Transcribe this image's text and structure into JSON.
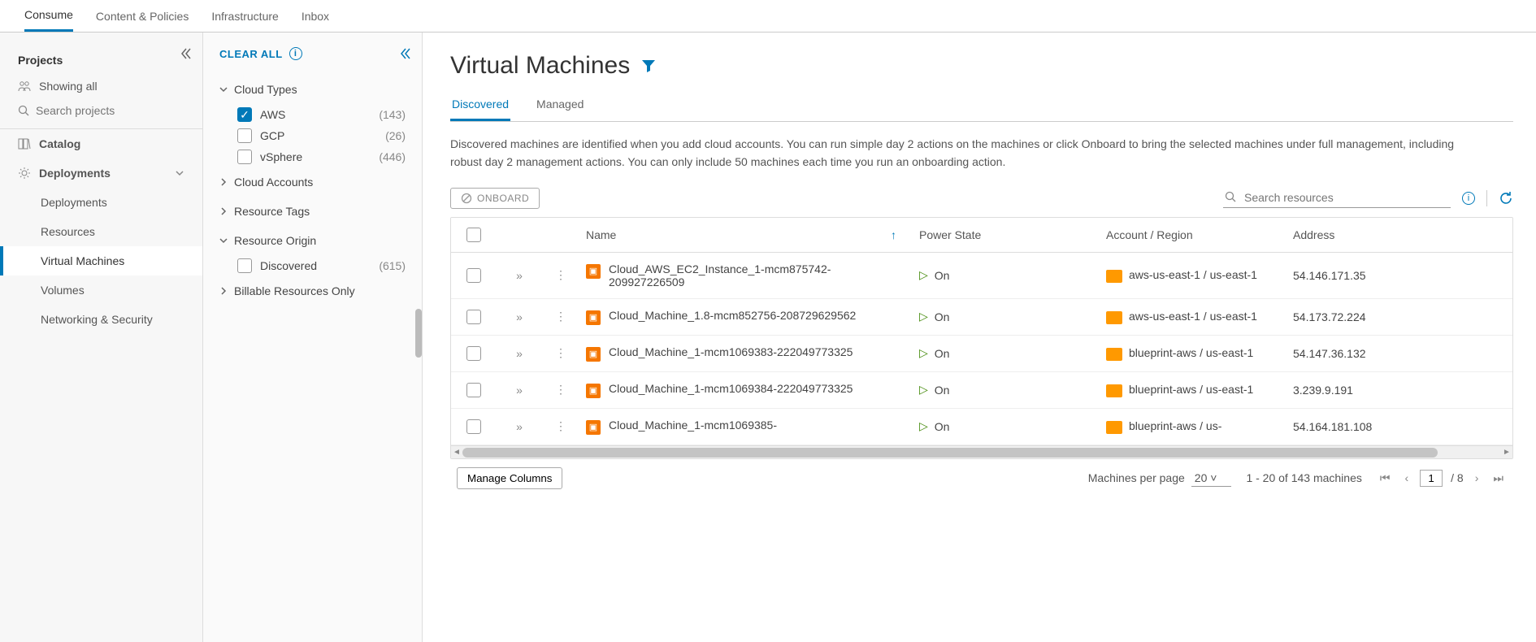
{
  "topTabs": {
    "t0": "Consume",
    "t1": "Content & Policies",
    "t2": "Infrastructure",
    "t3": "Inbox"
  },
  "sidebar": {
    "projects": "Projects",
    "showingAll": "Showing all",
    "searchPlaceholder": "Search projects",
    "catalog": "Catalog",
    "deployments": "Deployments",
    "deploymentsSub": "Deployments",
    "resources": "Resources",
    "vms": "Virtual Machines",
    "volumes": "Volumes",
    "network": "Networking & Security"
  },
  "filters": {
    "clearAll": "CLEAR ALL",
    "cloudTypes": "Cloud Types",
    "aws": "AWS",
    "awsCount": "(143)",
    "gcp": "GCP",
    "gcpCount": "(26)",
    "vsphere": "vSphere",
    "vsphereCount": "(446)",
    "cloudAccounts": "Cloud Accounts",
    "resourceTags": "Resource Tags",
    "resourceOrigin": "Resource Origin",
    "discovered": "Discovered",
    "discoveredCount": "(615)",
    "billable": "Billable Resources Only"
  },
  "page": {
    "title": "Virtual Machines",
    "tabDiscovered": "Discovered",
    "tabManaged": "Managed",
    "description": "Discovered machines are identified when you add cloud accounts. You can run simple day 2 actions on the machines or click Onboard to bring the selected machines under full management, including robust day 2 management actions. You can only include 50 machines each time you run an onboarding action.",
    "onboard": "ONBOARD",
    "searchPlaceholder": "Search resources"
  },
  "columns": {
    "name": "Name",
    "power": "Power State",
    "account": "Account / Region",
    "address": "Address"
  },
  "rows": [
    {
      "name": "Cloud_AWS_EC2_Instance_1-mcm875742-209927226509",
      "power": "On",
      "account": "aws-us-east-1 / us-east-1",
      "address": "54.146.171.35"
    },
    {
      "name": "Cloud_Machine_1.8-mcm852756-208729629562",
      "power": "On",
      "account": "aws-us-east-1 / us-east-1",
      "address": "54.173.72.224"
    },
    {
      "name": "Cloud_Machine_1-mcm1069383-222049773325",
      "power": "On",
      "account": "blueprint-aws / us-east-1",
      "address": "54.147.36.132"
    },
    {
      "name": "Cloud_Machine_1-mcm1069384-222049773325",
      "power": "On",
      "account": "blueprint-aws / us-east-1",
      "address": "3.239.9.191"
    },
    {
      "name": "Cloud_Machine_1-mcm1069385-",
      "power": "On",
      "account": "blueprint-aws / us-",
      "address": "54.164.181.108"
    }
  ],
  "footer": {
    "manageColumns": "Manage Columns",
    "perPageLabel": "Machines per page",
    "perPageValue": "20",
    "rangeText": "1 - 20 of 143 machines",
    "pageCurrent": "1",
    "pageTotal": "/ 8"
  }
}
